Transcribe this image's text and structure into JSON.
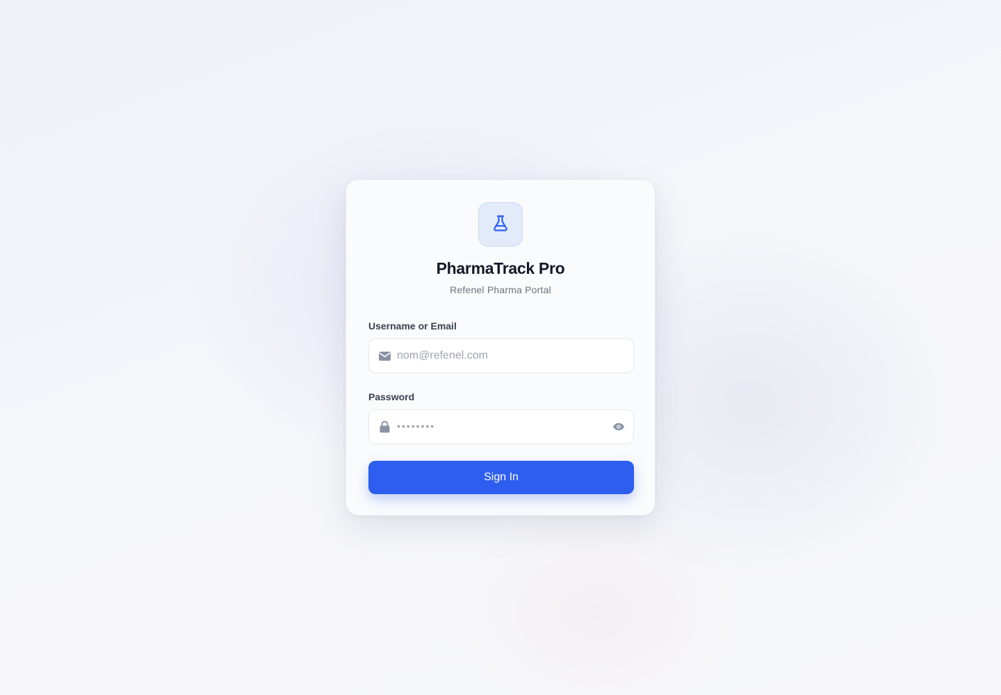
{
  "brand": {
    "title": "PharmaTrack Pro",
    "subtitle": "Refenel Pharma Portal",
    "logo_icon": "flask-icon",
    "accent_color": "#2d5eef"
  },
  "form": {
    "username": {
      "label": "Username or Email",
      "placeholder": "nom@refenel.com",
      "value": "",
      "icon": "mail-icon"
    },
    "password": {
      "label": "Password",
      "placeholder": "••••••••",
      "value": "",
      "icon": "lock-icon",
      "toggle_icon": "eye-icon"
    },
    "submit_label": "Sign In"
  }
}
